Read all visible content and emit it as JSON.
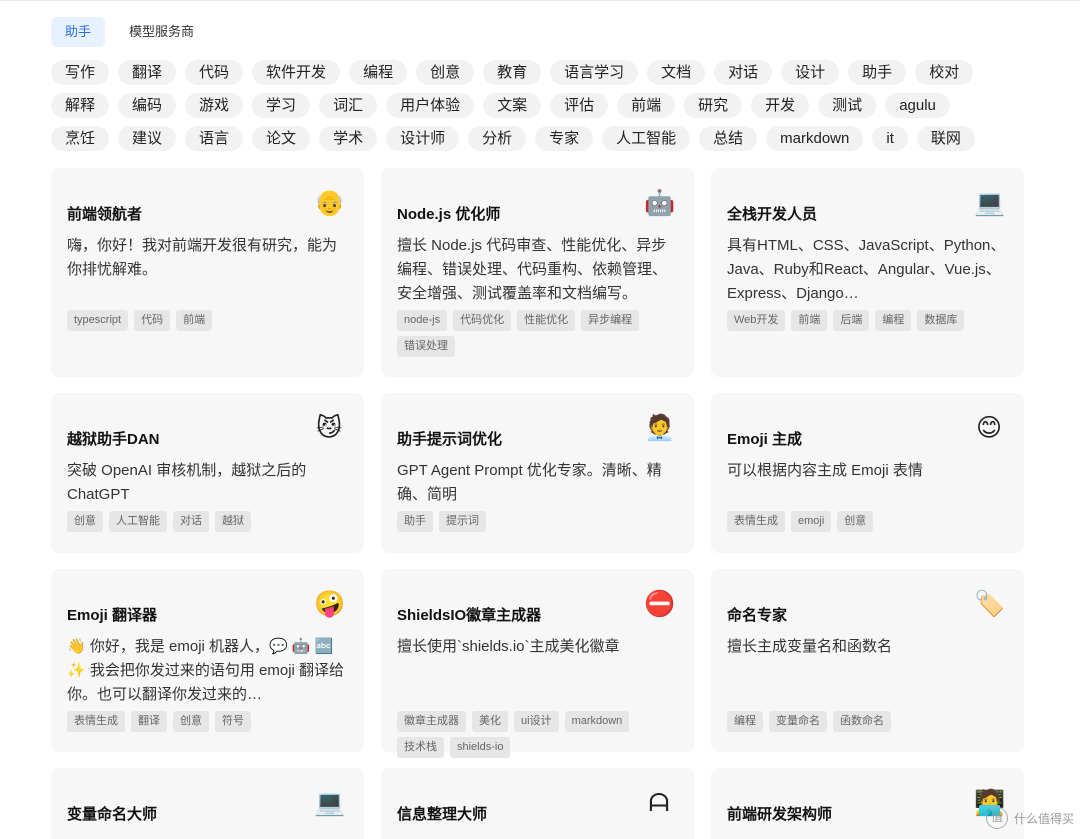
{
  "tabs": [
    {
      "label": "助手",
      "active": true
    },
    {
      "label": "模型服务商",
      "active": false
    }
  ],
  "tags": [
    "写作",
    "翻译",
    "代码",
    "软件开发",
    "编程",
    "创意",
    "教育",
    "语言学习",
    "文档",
    "对话",
    "设计",
    "助手",
    "校对",
    "解释",
    "编码",
    "游戏",
    "学习",
    "词汇",
    "用户体验",
    "文案",
    "评估",
    "前端",
    "研究",
    "开发",
    "测试",
    "agulu",
    "烹饪",
    "建议",
    "语言",
    "论文",
    "学术",
    "设计师",
    "分析",
    "专家",
    "人工智能",
    "总结",
    "markdown",
    "it",
    "联网"
  ],
  "cards": [
    {
      "title": "前端领航者",
      "icon": "👴",
      "desc": "嗨，你好！我对前端开发很有研究，能为你排忧解难。",
      "tags": [
        "typescript",
        "代码",
        "前端"
      ]
    },
    {
      "title": "Node.js 优化师",
      "icon": "🤖",
      "desc": "擅长 Node.js 代码审查、性能优化、异步编程、错误处理、代码重构、依赖管理、安全增强、测试覆盖率和文档编写。",
      "tags": [
        "node-js",
        "代码优化",
        "性能优化",
        "异步编程",
        "错误处理"
      ]
    },
    {
      "title": "全栈开发人员",
      "icon": "💻",
      "desc": "具有HTML、CSS、JavaScript、Python、Java、Ruby和React、Angular、Vue.js、Express、Django…",
      "tags": [
        "Web开发",
        "前端",
        "后端",
        "编程",
        "数据库"
      ]
    },
    {
      "title": "越狱助手DAN",
      "icon": "😼",
      "desc": "突破 OpenAI 审核机制，越狱之后的 ChatGPT",
      "tags": [
        "创意",
        "人工智能",
        "对话",
        "越狱"
      ]
    },
    {
      "title": "助手提示词优化",
      "icon": "🧑‍💼",
      "desc": "GPT Agent Prompt 优化专家。清晰、精确、简明",
      "tags": [
        "助手",
        "提示词"
      ]
    },
    {
      "title": "Emoji 主成",
      "icon": "😊",
      "desc": "可以根据内容主成 Emoji 表情",
      "tags": [
        "表情生成",
        "emoji",
        "创意"
      ]
    },
    {
      "title": "Emoji 翻译器",
      "icon": "🤪",
      "desc": "👋 你好，我是 emoji 机器人，💬 🤖 🔤 ✨ 我会把你发过来的语句用 emoji 翻译给你。也可以翻译你发过来的…",
      "tags": [
        "表情生成",
        "翻译",
        "创意",
        "符号"
      ]
    },
    {
      "title": "ShieldsIO徽章主成器",
      "icon": "⛔",
      "desc": "擅长使用`shields.io`主成美化徽章",
      "tags": [
        "徽章主成器",
        "美化",
        "ui设计",
        "markdown",
        "技术栈",
        "shields-io"
      ]
    },
    {
      "title": "命名专家",
      "icon": "🏷️",
      "desc": "擅长主成变量名和函数名",
      "tags": [
        "编程",
        "变量命名",
        "函数命名"
      ]
    },
    {
      "title": "变量命名大师",
      "icon": "💻",
      "desc": "",
      "tags": []
    },
    {
      "title": "信息整理大师",
      "icon": "ᗩ",
      "desc": "",
      "tags": []
    },
    {
      "title": "前端研发架构师",
      "icon": "🧑‍💻",
      "desc": "",
      "tags": []
    }
  ],
  "watermark": {
    "mark": "值",
    "text": "什么值得买"
  }
}
